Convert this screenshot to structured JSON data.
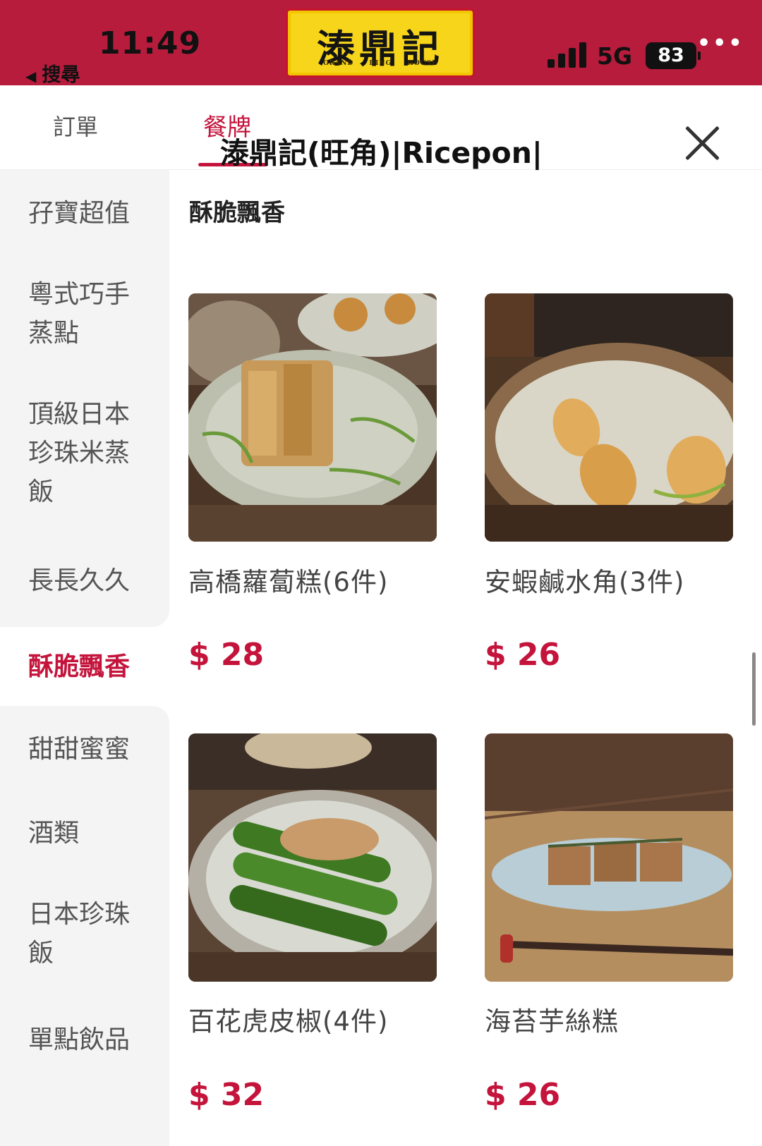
{
  "status_bar": {
    "time": "11:49",
    "back_label": "搜尋",
    "back_icon": "back-triangle-icon",
    "network": "5G",
    "battery": "83",
    "more": "•••",
    "background": "#b71c3c"
  },
  "logo": {
    "name_cn": "溙鼎記",
    "name_en": "GRAND DING HOUSE",
    "background": "#f7d51b"
  },
  "header": {
    "tab_orders": "訂單",
    "tab_menu": "餐牌",
    "overlay_title": "溙鼎記(旺角)|Ricepon|",
    "close_icon": "close-icon",
    "accent_color": "#c4143c"
  },
  "sidebar": {
    "items": [
      {
        "label": "孖寶超值",
        "active": false
      },
      {
        "label": "粵式巧手蒸點",
        "active": false
      },
      {
        "label": "頂級日本珍珠米蒸飯",
        "active": false
      },
      {
        "label": "長長久久",
        "active": false
      },
      {
        "label": "酥脆飄香",
        "active": true
      },
      {
        "label": "甜甜蜜蜜",
        "active": false
      },
      {
        "label": "酒類",
        "active": false
      },
      {
        "label": "日本珍珠飯",
        "active": false
      },
      {
        "label": "單點飲品",
        "active": false
      }
    ]
  },
  "main": {
    "section_title": "酥脆飄香",
    "products": [
      {
        "name": "高橋蘿蔔糕(6件)",
        "price": "$ 28",
        "image": "turnip-cake-photo"
      },
      {
        "name": "安蝦鹹水角(3件)",
        "price": "$ 26",
        "image": "fried-dumpling-photo"
      },
      {
        "name": "百花虎皮椒(4件)",
        "price": "$ 32",
        "image": "stuffed-pepper-photo"
      },
      {
        "name": "海苔芋絲糕",
        "price": "$ 26",
        "image": "taro-cake-photo"
      }
    ]
  }
}
